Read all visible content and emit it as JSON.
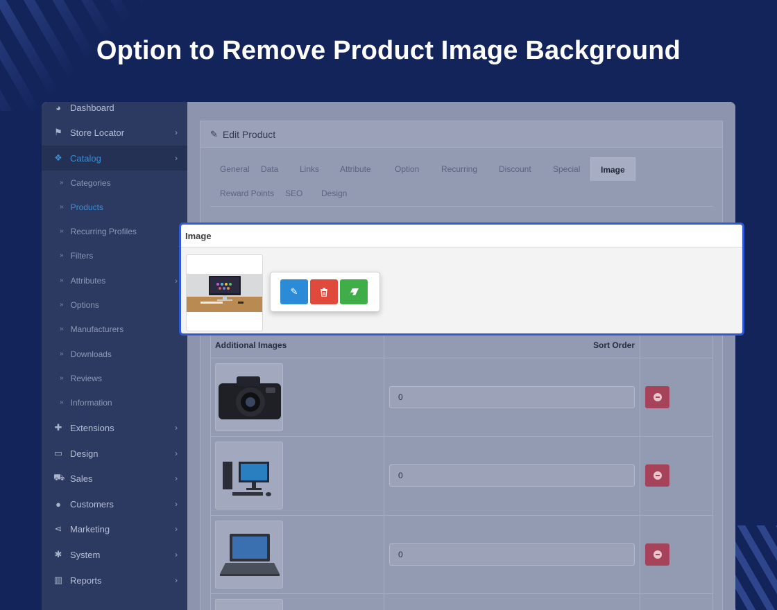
{
  "headline": "Option to Remove Product Image Background",
  "colors": {
    "background": "#13245a",
    "highlight_border": "#2f5bd9",
    "edit_button": "#2b8bd6",
    "delete_button": "#e04a3c",
    "remove_bg_button": "#3fae49",
    "active_link": "#3b8fd2"
  },
  "sidebar": {
    "items": [
      {
        "label": "Dashboard",
        "icon": "dashboard-icon",
        "glyph": "◕",
        "chevron": false
      },
      {
        "label": "Store Locator",
        "icon": "flag-icon",
        "glyph": "⚑",
        "chevron": true
      },
      {
        "label": "Catalog",
        "icon": "tags-icon",
        "glyph": "❖",
        "chevron": true,
        "active": true
      }
    ],
    "catalog_sub": [
      {
        "label": "Categories"
      },
      {
        "label": "Products",
        "active": true
      },
      {
        "label": "Recurring Profiles"
      },
      {
        "label": "Filters"
      },
      {
        "label": "Attributes",
        "chevron": true
      },
      {
        "label": "Options"
      },
      {
        "label": "Manufacturers"
      },
      {
        "label": "Downloads"
      },
      {
        "label": "Reviews"
      },
      {
        "label": "Information"
      }
    ],
    "items_bottom": [
      {
        "label": "Extensions",
        "icon": "puzzle-icon",
        "glyph": "✚"
      },
      {
        "label": "Design",
        "icon": "monitor-icon",
        "glyph": "▭"
      },
      {
        "label": "Sales",
        "icon": "cart-icon",
        "glyph": "⛟"
      },
      {
        "label": "Customers",
        "icon": "user-icon",
        "glyph": "●"
      },
      {
        "label": "Marketing",
        "icon": "share-icon",
        "glyph": "⋖"
      },
      {
        "label": "System",
        "icon": "cog-icon",
        "glyph": "✱"
      },
      {
        "label": "Reports",
        "icon": "bar-chart-icon",
        "glyph": "▥"
      }
    ],
    "chevron_glyph": "›",
    "sub_bullet_glyph": "»"
  },
  "panel": {
    "title": "Edit Product",
    "tabs_row1": [
      "General",
      "Data",
      "Links",
      "Attribute",
      "Option",
      "Recurring",
      "Discount",
      "Special",
      "Image"
    ],
    "tabs_row2": [
      "Reward Points",
      "SEO",
      "Design"
    ],
    "active_tab": "Image"
  },
  "image_section": {
    "heading": "Image"
  },
  "additional_images": {
    "col_image": "Additional Images",
    "col_sort": "Sort Order",
    "rows": [
      {
        "image": "camera-image",
        "sort_order": "0"
      },
      {
        "image": "desktop-computer-image",
        "sort_order": "0"
      },
      {
        "image": "laptop-image",
        "sort_order": "0"
      }
    ]
  }
}
